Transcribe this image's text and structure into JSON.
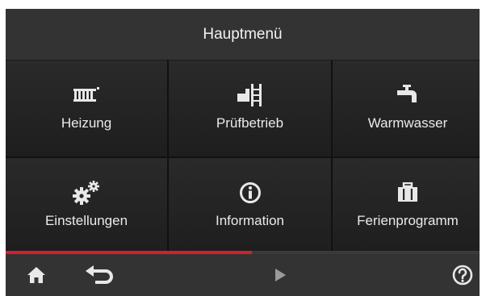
{
  "header": {
    "title": "Hauptmenü"
  },
  "menu": {
    "tiles": [
      {
        "label": "Heizung",
        "icon": "radiator-icon"
      },
      {
        "label": "Prüfbetrieb",
        "icon": "chimney-ladder-icon"
      },
      {
        "label": "Warmwasser",
        "icon": "faucet-icon"
      },
      {
        "label": "Einstellungen",
        "icon": "gears-icon"
      },
      {
        "label": "Information",
        "icon": "info-icon"
      },
      {
        "label": "Ferienprogramm",
        "icon": "suitcase-icon"
      }
    ]
  },
  "progress": {
    "fraction": 0.52,
    "color": "#d4202a"
  },
  "footer": {
    "home_icon": "home-icon",
    "back_icon": "back-arrow-icon",
    "next_icon": "play-icon",
    "help_icon": "help-icon"
  }
}
